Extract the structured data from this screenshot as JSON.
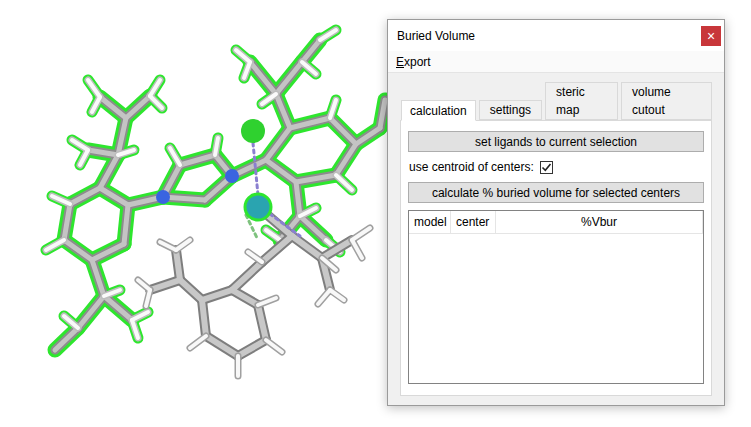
{
  "window": {
    "title": "Buried Volume",
    "close": "×"
  },
  "menu": [
    "Export"
  ],
  "tabs": [
    {
      "label": "calculation",
      "selected": true
    },
    {
      "label": "settings",
      "selected": false
    },
    {
      "label": "steric map",
      "selected": false
    },
    {
      "label": "volume cutout",
      "selected": false
    }
  ],
  "buttons": [
    "set ligands to current selection",
    "calculate % buried volume for selected centers"
  ],
  "checkbox": {
    "label": "use centroid of centers:",
    "checked": true
  },
  "table": {
    "columns": [
      "model",
      "center",
      "%Vbur"
    ],
    "rows": []
  }
}
